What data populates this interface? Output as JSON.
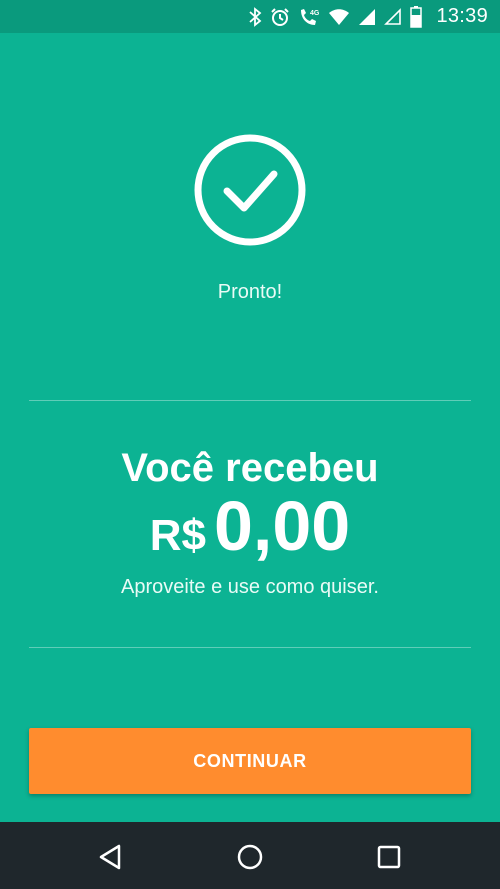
{
  "status_bar": {
    "time": "13:39",
    "icons": [
      "bluetooth-icon",
      "alarm-icon",
      "4g-call-icon",
      "wifi-icon",
      "signal-icon",
      "signal-empty-icon",
      "battery-icon"
    ],
    "network_label": "4G"
  },
  "success": {
    "icon": "check-circle-icon",
    "message": "Pronto!"
  },
  "reward": {
    "headline": "Você recebeu",
    "currency": "R$",
    "amount": "0,00",
    "subtext": "Aproveite e use como quiser."
  },
  "actions": {
    "continue_label": "CONTINUAR"
  },
  "nav_bar": {
    "icons": [
      "back-icon",
      "home-icon",
      "recents-icon"
    ]
  },
  "colors": {
    "background": "#0cb393",
    "status_bar": "#0a9a7d",
    "button": "#ff8c2e",
    "nav_bar": "#1f272c"
  }
}
